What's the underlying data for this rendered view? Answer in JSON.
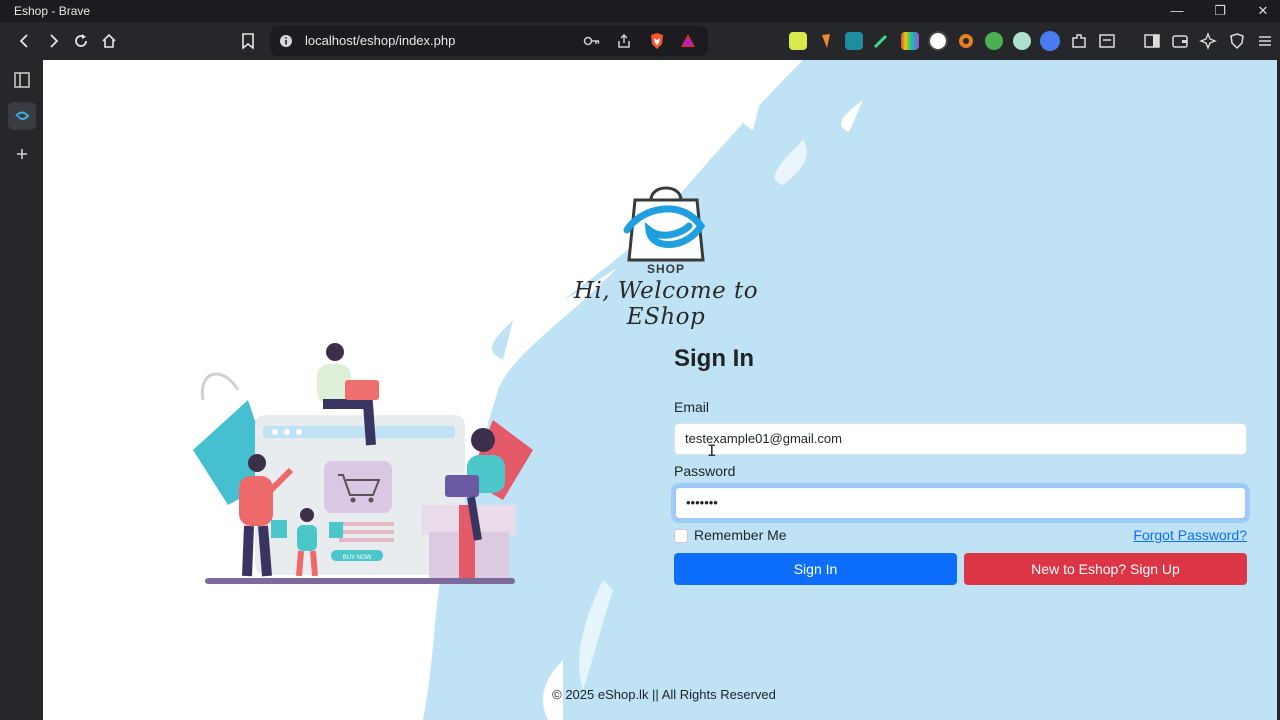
{
  "window": {
    "title": "Eshop - Brave"
  },
  "toolbar": {
    "url": "localhost/eshop/index.php"
  },
  "page": {
    "logo_text": "SHOP",
    "welcome": "Hi, Welcome to EShop",
    "signin": {
      "title": "Sign In",
      "email_label": "Email",
      "email_value": "testexample01@gmail.com",
      "password_label": "Password",
      "password_value": "•••••••",
      "remember_label": "Remember Me",
      "forgot_label": "Forgot Password?",
      "signin_button": "Sign In",
      "signup_button": "New to Eshop? Sign Up"
    },
    "illustration": {
      "buy_now": "BUY NOW"
    },
    "footer": "© 2025 eShop.lk || All Rights Reserved"
  },
  "colors": {
    "primary": "#0d6efd",
    "danger": "#dc3545",
    "background_stroke": "#bfe3f5"
  }
}
